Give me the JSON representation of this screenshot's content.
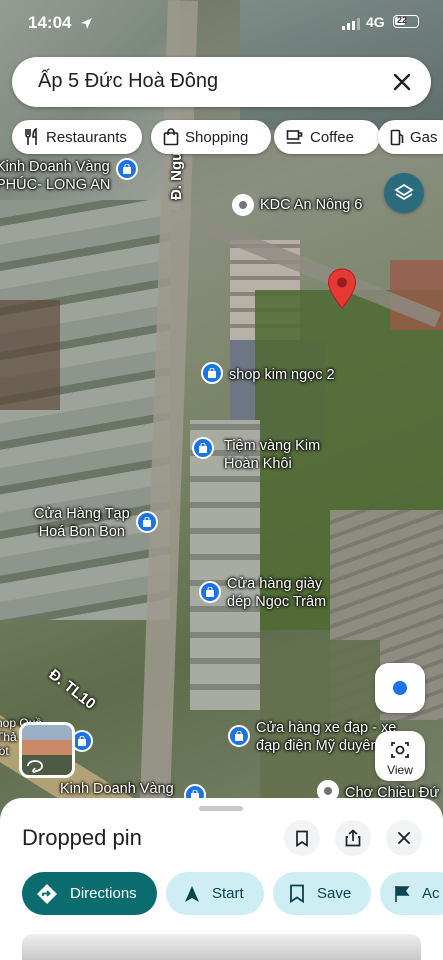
{
  "status_bar": {
    "time": "14:04",
    "network": "4G",
    "battery": "22"
  },
  "search": {
    "query": "Ấp 5 Đức Hoà Đông"
  },
  "chips": [
    {
      "label": "Restaurants",
      "icon": "fork-knife-icon"
    },
    {
      "label": "Shopping",
      "icon": "shopping-bag-icon"
    },
    {
      "label": "Coffee",
      "icon": "coffee-icon"
    },
    {
      "label": "Gas",
      "icon": "gas-icon"
    }
  ],
  "map": {
    "roads": {
      "nguyen": "Đ. Nguyễn",
      "tl10": "Đ. TL10"
    },
    "poi": {
      "kdc": "KDC An Nông 6",
      "vang_top": "Kinh Doanh Vàng\nPHÚC- LONG AN",
      "kim_ngoc": "shop kim ngọc 2",
      "kim_hoan": "Tiệm vàng Kim\nHoàn Khôi",
      "tap_hoa": "Cửa Hàng Tạp\nHoá Bon Bon",
      "giay_dep": "Cửa hàng giày\ndép Ngọc Trâm",
      "xe_dap": "Cửa hàng xe đạp - xe\nđạp điện Mỹ duyên",
      "shop_left": "hop Quầ\nThả\nlot",
      "vang_bottom": "Kinh Doanh Vàng",
      "cho": "Chợ Chiều Đứ"
    },
    "view_label": "View"
  },
  "sheet": {
    "title": "Dropped pin",
    "actions": {
      "directions": "Directions",
      "start": "Start",
      "save": "Save",
      "more": "Ac"
    }
  },
  "colors": {
    "primary": "#0b6c6f",
    "secondary": "#cfeef3",
    "pin": "#e53935",
    "poi": "#1a73e8"
  }
}
